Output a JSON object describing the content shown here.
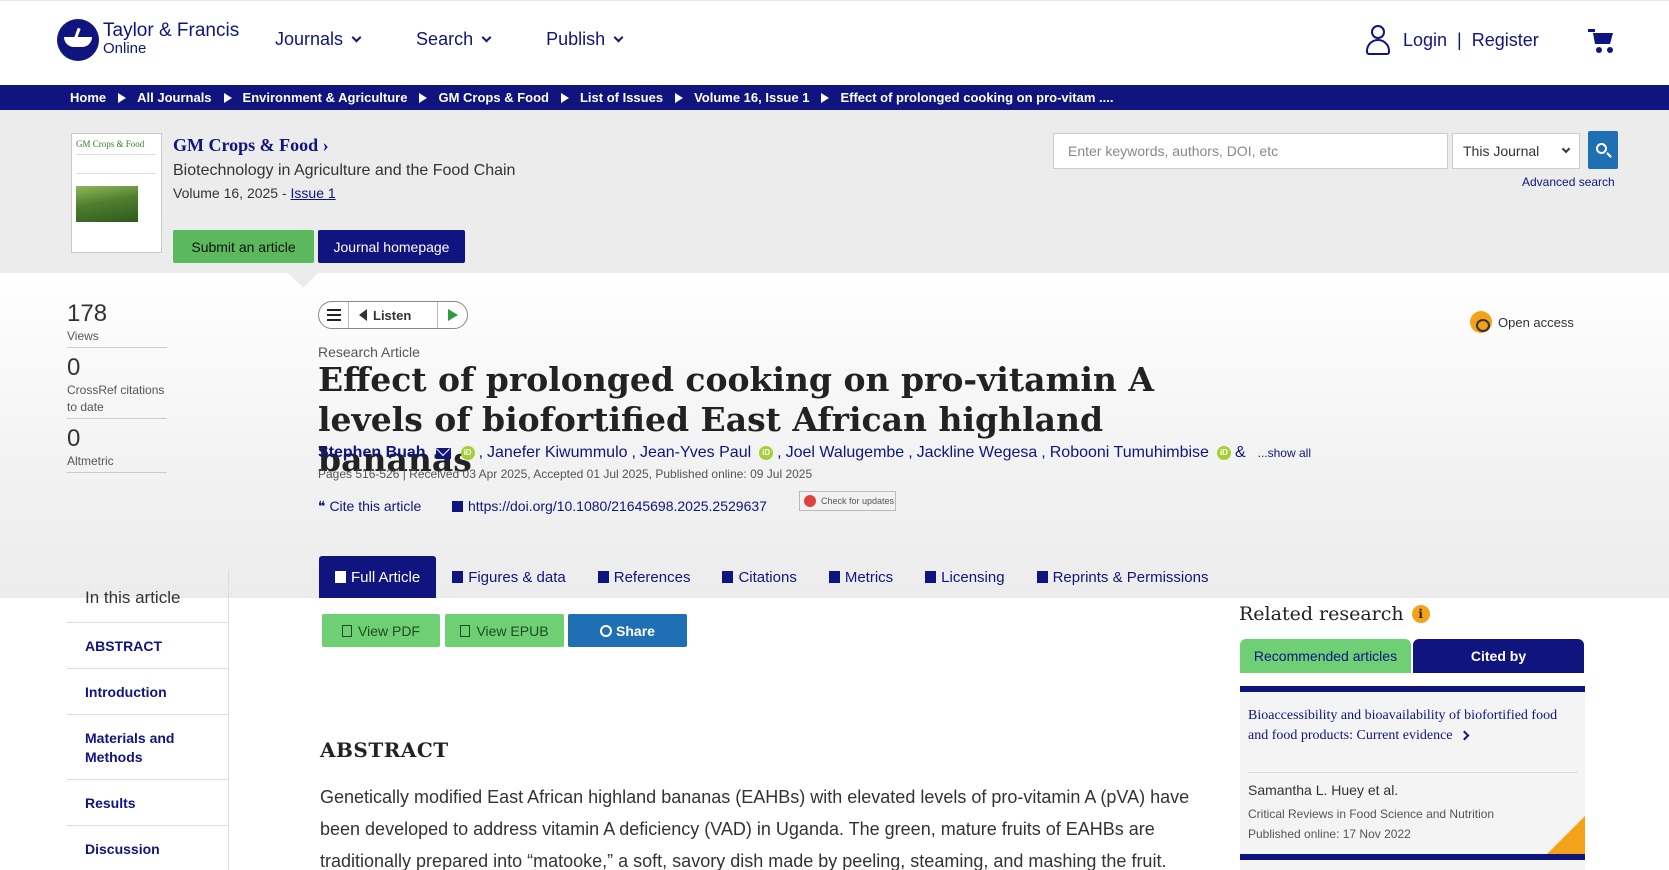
{
  "header": {
    "logo_line1": "Taylor & Francis",
    "logo_line2": "Online",
    "nav": [
      "Journals",
      "Search",
      "Publish"
    ],
    "login": "Login",
    "separator": "|",
    "register": "Register"
  },
  "breadcrumbs": [
    "Home",
    "All Journals",
    "Environment & Agriculture",
    "GM Crops & Food",
    "List of Issues",
    "Volume 16, Issue 1",
    "Effect of prolonged cooking on pro-vitam ...."
  ],
  "journal": {
    "cover_title": "GM Crops & Food",
    "title": "GM Crops & Food ›",
    "subtitle": "Biotechnology in Agriculture and the Food Chain",
    "volume_prefix": "Volume 16, 2025 - ",
    "issue_link": "Issue 1",
    "submit_label": "Submit an article",
    "homepage_label": "Journal homepage"
  },
  "search": {
    "placeholder": "Enter keywords, authors, DOI, etc",
    "scope": "This Journal",
    "advanced": "Advanced search"
  },
  "metrics": [
    {
      "value": "178",
      "label": "Views"
    },
    {
      "value": "0",
      "label": "CrossRef citations to date"
    },
    {
      "value": "0",
      "label": "Altmetric"
    }
  ],
  "listen": {
    "label": "Listen"
  },
  "article": {
    "access": "Open access",
    "type": "Research Article",
    "title": "Effect of prolonged cooking on pro-vitamin A levels of biofortified East African highland bananas",
    "authors": [
      "Stephen Buah",
      "Janefer Kiwummulo",
      "Jean-Yves Paul",
      "Joel Walugembe",
      "Jackline Wegesa",
      "Robooni Tumuhimbise"
    ],
    "ampersand": "&",
    "show_all": "...show all",
    "dates": "Pages 516-526 | Received 03 Apr 2025, Accepted 01 Jul 2025, Published online: 09 Jul 2025",
    "cite": "Cite this article",
    "doi": "https://doi.org/10.1080/21645698.2025.2529637",
    "check_updates": "Check for updates",
    "orcid_glyph": "iD"
  },
  "tabs": [
    "Full Article",
    "Figures & data",
    "References",
    "Citations",
    "Metrics",
    "Licensing",
    "Reprints & Permissions"
  ],
  "toc": {
    "heading": "In this article",
    "items": [
      "ABSTRACT",
      "Introduction",
      "Materials and Methods",
      "Results",
      "Discussion"
    ]
  },
  "actions": {
    "pdf": "View PDF",
    "epub": "View EPUB",
    "share": "Share"
  },
  "abstract": {
    "heading": "ABSTRACT",
    "text": "Genetically modified East African highland bananas (EAHBs) with elevated levels of pro-vitamin A (pVA) have been developed to address vitamin A deficiency (VAD) in Uganda. The green, mature fruits of EAHBs are traditionally prepared into “matooke,” a soft, savory dish made by peeling, steaming, and mashing the fruit."
  },
  "related": {
    "heading": "Related research",
    "info_glyph": "i",
    "tab_recommended": "Recommended articles",
    "tab_cited": "Cited by",
    "card": {
      "title": "Bioaccessibility and bioavailability of biofortified food and food products: Current evidence",
      "authors": "Samantha L. Huey et al.",
      "source": "Critical Reviews in Food Science and Nutrition",
      "date": "Published online: 17 Nov 2022"
    }
  },
  "colors": {
    "brand_navy": "#10147e",
    "green": "#6fcf75",
    "share_blue": "#1f6fb5",
    "oa_orange": "#f5a21b"
  }
}
